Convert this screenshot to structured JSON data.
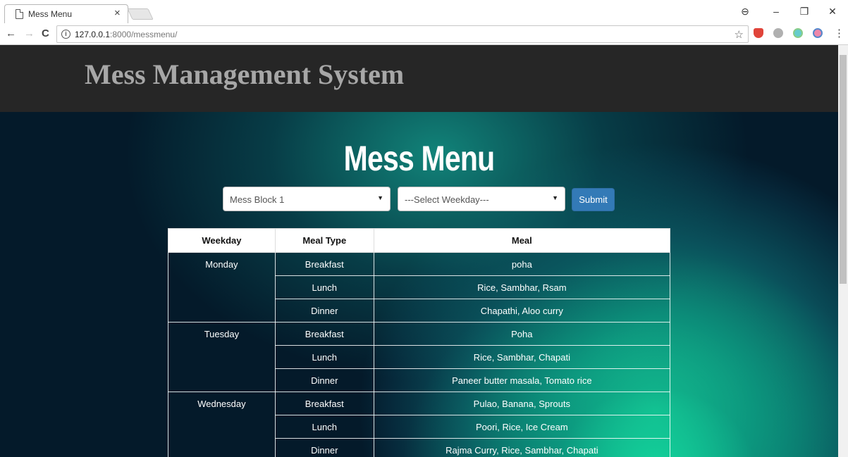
{
  "browser": {
    "tab_title": "Mess Menu",
    "tab_close": "×",
    "url_host": "127.0.0.1",
    "url_rest": ":8000/messmenu/",
    "back": "←",
    "forward": "→",
    "reload": "C",
    "info": "i",
    "star": "☆",
    "menu": "⋮",
    "minimize": "–",
    "restore": "❐",
    "close": "✕",
    "profile": "⊖"
  },
  "header": {
    "title": "Mess Management System"
  },
  "main": {
    "heading": "Mess Menu",
    "block_select": {
      "value": "Mess Block 1"
    },
    "weekday_select": {
      "value": "---Select Weekday---"
    },
    "submit_label": "Submit",
    "table": {
      "columns": [
        "Weekday",
        "Meal Type",
        "Meal"
      ],
      "days": [
        {
          "day": "Monday",
          "meals": [
            {
              "type": "Breakfast",
              "meal": "poha"
            },
            {
              "type": "Lunch",
              "meal": "Rice, Sambhar, Rsam"
            },
            {
              "type": "Dinner",
              "meal": "Chapathi, Aloo curry"
            }
          ]
        },
        {
          "day": "Tuesday",
          "meals": [
            {
              "type": "Breakfast",
              "meal": "Poha"
            },
            {
              "type": "Lunch",
              "meal": "Rice, Sambhar, Chapati"
            },
            {
              "type": "Dinner",
              "meal": "Paneer butter masala, Tomato rice"
            }
          ]
        },
        {
          "day": "Wednesday",
          "meals": [
            {
              "type": "Breakfast",
              "meal": "Pulao, Banana, Sprouts"
            },
            {
              "type": "Lunch",
              "meal": "Poori, Rice, Ice Cream"
            },
            {
              "type": "Dinner",
              "meal": "Rajma Curry, Rice, Sambhar, Chapati"
            }
          ]
        }
      ]
    }
  },
  "colors": {
    "header_bg": "#262626",
    "submit_bg": "#337ab7",
    "accent_glow": "#1ad39a"
  }
}
